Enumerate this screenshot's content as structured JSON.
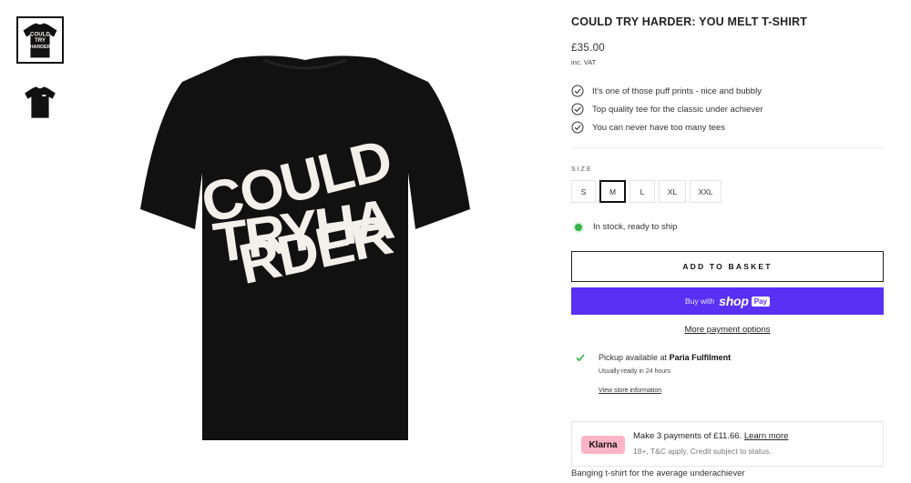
{
  "product": {
    "title": "COULD TRY HARDER: YOU MELT T-SHIRT",
    "price": "£35.00",
    "vat_note": "inc. VAT",
    "features": [
      "It's one of those puff prints - nice and bubbly",
      "Top quality tee for the classic under achiever",
      "You can never have too many tees"
    ],
    "print_text": [
      "COULD",
      "TRYHA",
      "RDER"
    ],
    "thumb_print_text": [
      "COULD",
      "TRY",
      "HARDER"
    ],
    "tagline": "Banging t-shirt for the average underachiever"
  },
  "size": {
    "label": "SIZE",
    "options": [
      "S",
      "M",
      "L",
      "XL",
      "XXL"
    ],
    "selected": "M"
  },
  "stock": {
    "text": "In stock, ready to ship"
  },
  "actions": {
    "add_to_basket": "ADD TO BASKET",
    "buy_with": "Buy with",
    "shop_word": "shop",
    "pay_word": "Pay",
    "more_payment": "More payment options"
  },
  "pickup": {
    "prefix": "Pickup available at",
    "location": "Paria Fulfilment",
    "ready": "Usually ready in 24 hours",
    "store_link": "View store information"
  },
  "klarna": {
    "logo": "Klarna",
    "line1_prefix": "Make 3 payments of £11.66.",
    "learn_more": "Learn more",
    "line2": "18+, T&C apply, Credit subject to status."
  },
  "colors": {
    "shirt": "#111111",
    "print": "#f2f0ea",
    "shop_pay": "#5a31f4",
    "klarna_pink": "#ffb3c7",
    "stock_green": "#37b24d"
  }
}
